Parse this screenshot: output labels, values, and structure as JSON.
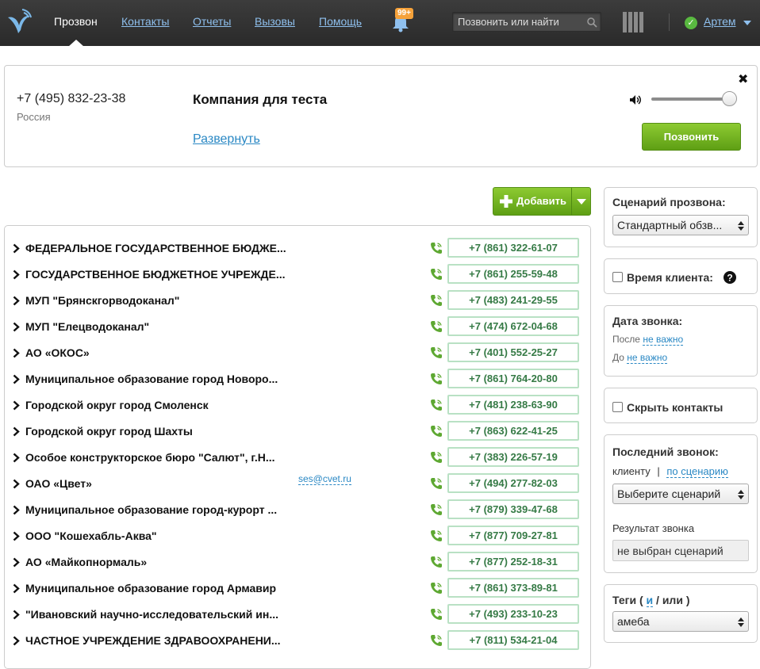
{
  "nav": {
    "items": [
      "Прозвон",
      "Контакты",
      "Отчеты",
      "Вызовы",
      "Помощь"
    ],
    "notifications_badge": "99+",
    "search_placeholder": "Позвонить или найти",
    "user_name": "Артем",
    "status": "online"
  },
  "call_panel": {
    "phone": "+7 (495) 832-23-38",
    "country": "Россия",
    "company": "Компания для теста",
    "expand_link": "Развернуть",
    "call_button": "Позвонить",
    "volume_level": 1.0
  },
  "add_button": {
    "label": "Добавить"
  },
  "contacts": [
    {
      "name": "ФЕДЕРАЛЬНОЕ ГОСУДАРСТВЕННОЕ БЮДЖЕ...",
      "phone": "+7 (861) 322-61-07"
    },
    {
      "name": "ГОСУДАРСТВЕННОЕ БЮДЖЕТНОЕ УЧРЕЖДЕ...",
      "phone": "+7 (861) 255-59-48"
    },
    {
      "name": "МУП \"Брянскгорводоканал\"",
      "phone": "+7 (483) 241-29-55"
    },
    {
      "name": "МУП \"Елецводоканал\"",
      "phone": "+7 (474) 672-04-68"
    },
    {
      "name": "АО «ОКОС»",
      "phone": "+7 (401) 552-25-27"
    },
    {
      "name": "Муниципальное образование город Новоро...",
      "phone": "+7 (861) 764-20-80"
    },
    {
      "name": "Городской округ город Смоленск",
      "phone": "+7 (481) 238-63-90"
    },
    {
      "name": "Городской округ город Шахты",
      "phone": "+7 (863) 622-41-25"
    },
    {
      "name": "Особое конструкторское бюро \"Салют\", г.Н...",
      "phone": "+7 (383) 226-57-19"
    },
    {
      "name": "ОАО «Цвет»",
      "email": "ses@cvet.ru",
      "phone": "+7 (494) 277-82-03"
    },
    {
      "name": "Муниципальное образование город-курорт ...",
      "phone": "+7 (879) 339-47-68"
    },
    {
      "name": "ООО \"Кошехабль-Аква\"",
      "phone": "+7 (877) 709-27-81"
    },
    {
      "name": "АО «Майкопнормаль»",
      "phone": "+7 (877) 252-18-31"
    },
    {
      "name": "Муниципальное образование город Армавир",
      "phone": "+7 (861) 373-89-81"
    },
    {
      "name": "\"Ивановский научно-исследовательский ин...",
      "phone": "+7 (493) 233-10-23"
    },
    {
      "name": "ЧАСТНОЕ УЧРЕЖДЕНИЕ ЗДРАВООХРАНЕНИ...",
      "phone": "+7 (811) 534-21-04"
    }
  ],
  "filters": {
    "scenario": {
      "title": "Сценарий прозвона:",
      "value": "Стандартный обзв..."
    },
    "client_time": {
      "label": "Время клиента:"
    },
    "call_date": {
      "title": "Дата звонка:",
      "after_label": "После",
      "after_value": "не важно",
      "before_label": "До",
      "before_value": "не важно"
    },
    "hide_contacts": {
      "label": "Скрыть контакты"
    },
    "last_call": {
      "title": "Последний звонок:",
      "to_client": "клиенту",
      "separator": "|",
      "by_scenario": "по сценарию",
      "scenario_select": "Выберите сценарий",
      "result_label": "Результат звонка",
      "result_value": "не выбран сценарий"
    },
    "tags": {
      "title_prefix": "Теги (",
      "and": "и",
      "slash": "/",
      "or": "или",
      "title_suffix": ")",
      "value": "амеба"
    }
  },
  "colors": {
    "topbar": "#333333",
    "link": "#2a88c4",
    "accent_green": "#6cb11f",
    "phone_text": "#357a45",
    "phone_border": "#b9e1c4",
    "badge": "#f6a23a"
  }
}
